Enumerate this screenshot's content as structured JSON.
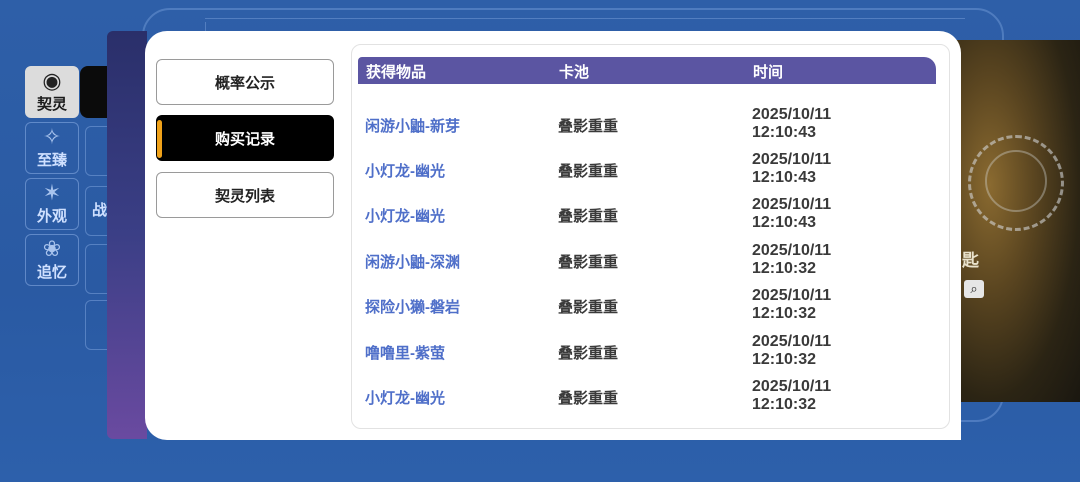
{
  "sidebar": {
    "items": [
      {
        "label": "契灵",
        "icon": "spirit-icon",
        "active": true
      },
      {
        "label": "至臻",
        "icon": "emblem-icon",
        "active": false
      },
      {
        "label": "外观",
        "icon": "outfit-icon",
        "active": false
      },
      {
        "label": "追忆",
        "icon": "memory-icon",
        "active": false
      }
    ],
    "partial_label": "战"
  },
  "menu": {
    "items": [
      {
        "label": "概率公示",
        "active": false
      },
      {
        "label": "购买记录",
        "active": true
      },
      {
        "label": "契灵列表",
        "active": false
      }
    ]
  },
  "table": {
    "headers": [
      "获得物品",
      "卡池",
      "时间"
    ],
    "rows": [
      {
        "item": "闲游小鼬-新芽",
        "pool": "叠影重重",
        "date": "2025/10/11",
        "time": "12:10:43"
      },
      {
        "item": "小灯龙-幽光",
        "pool": "叠影重重",
        "date": "2025/10/11",
        "time": "12:10:43"
      },
      {
        "item": "小灯龙-幽光",
        "pool": "叠影重重",
        "date": "2025/10/11",
        "time": "12:10:43"
      },
      {
        "item": "闲游小鼬-深渊",
        "pool": "叠影重重",
        "date": "2025/10/11",
        "time": "12:10:32"
      },
      {
        "item": "探险小獭-磐岩",
        "pool": "叠影重重",
        "date": "2025/10/11",
        "time": "12:10:32"
      },
      {
        "item": "噜噜里-紫萤",
        "pool": "叠影重重",
        "date": "2025/10/11",
        "time": "12:10:32"
      },
      {
        "item": "小灯龙-幽光",
        "pool": "叠影重重",
        "date": "2025/10/11",
        "time": "12:10:32"
      }
    ]
  },
  "background_art": {
    "partial_text": "匙",
    "search_icon": "search-icon"
  },
  "colors": {
    "header_bg": "#5b55a2",
    "item_link": "#4f6fc9",
    "active_accent": "#f0a21a",
    "page_bg": "#2e5fa8"
  }
}
